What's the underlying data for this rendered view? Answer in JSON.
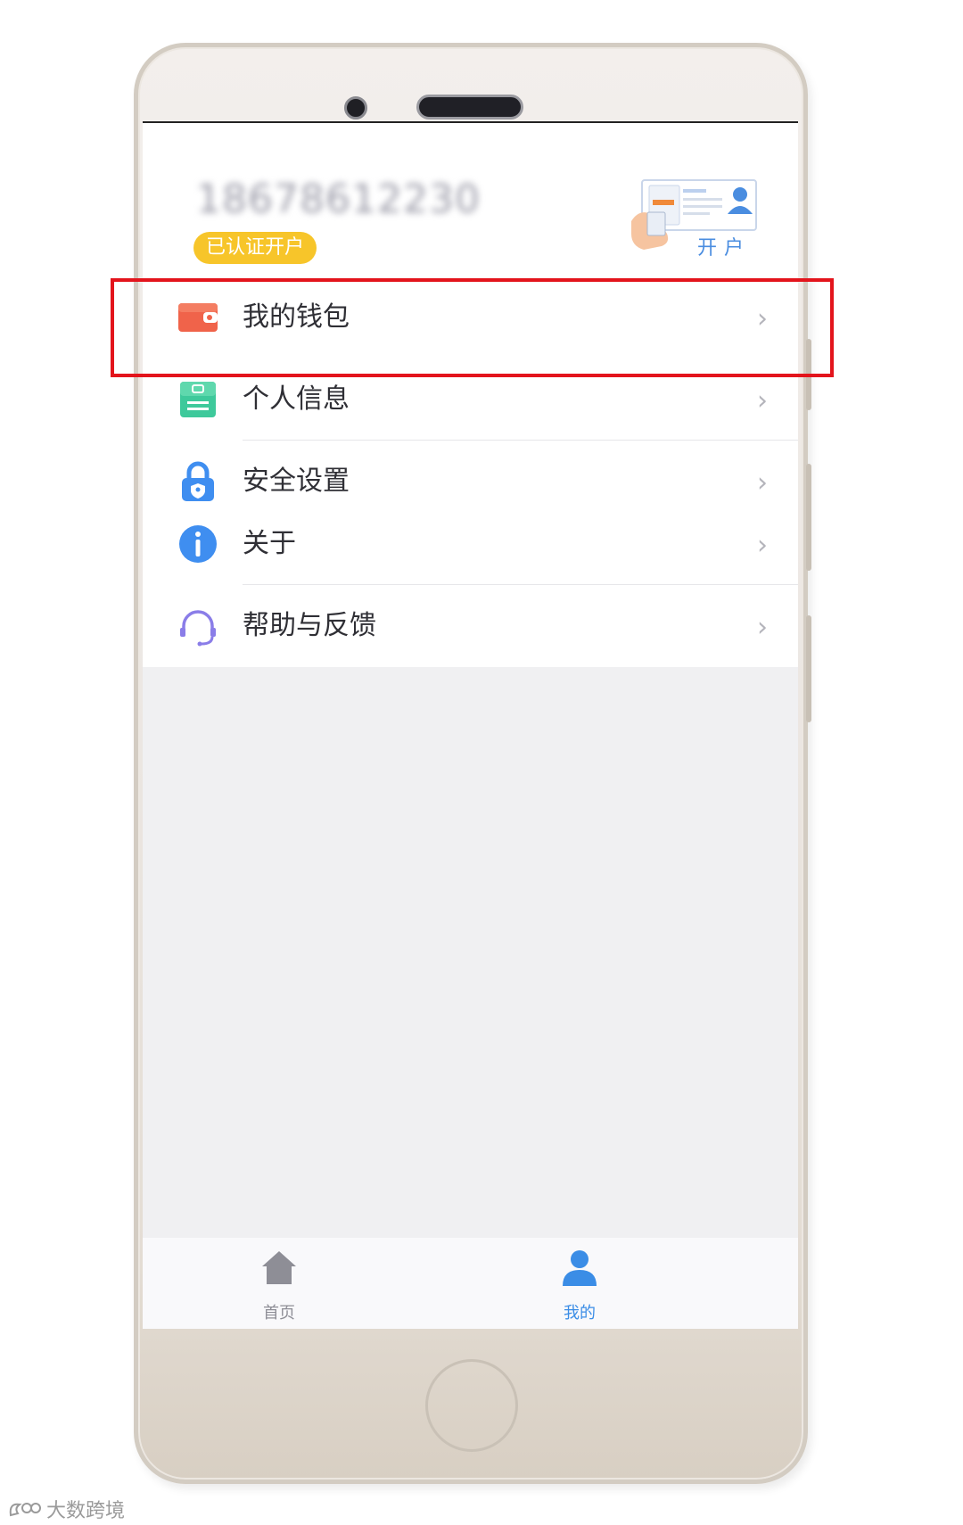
{
  "account": {
    "phone_number": "18678612230",
    "verified_badge": "已认证开户",
    "open_account_label": "开户"
  },
  "menu": {
    "group1": [
      {
        "label": "我的钱包",
        "icon": "wallet-icon",
        "color": "#f0634a"
      },
      {
        "label": "个人信息",
        "icon": "id-card-icon",
        "color": "#3ec99b"
      },
      {
        "label": "安全设置",
        "icon": "lock-icon",
        "color": "#3f8ef0"
      }
    ],
    "group2": [
      {
        "label": "关于",
        "icon": "info-icon",
        "color": "#3f8ef0"
      },
      {
        "label": "帮助与反馈",
        "icon": "headset-icon",
        "color": "#8a7de8"
      }
    ],
    "chevron": "›"
  },
  "tabbar": {
    "home_label": "首页",
    "mine_label": "我的",
    "active_tab": "我的",
    "active_color": "#3b8de6",
    "inactive_color": "#8e8e96"
  },
  "watermark": "大数跨境"
}
